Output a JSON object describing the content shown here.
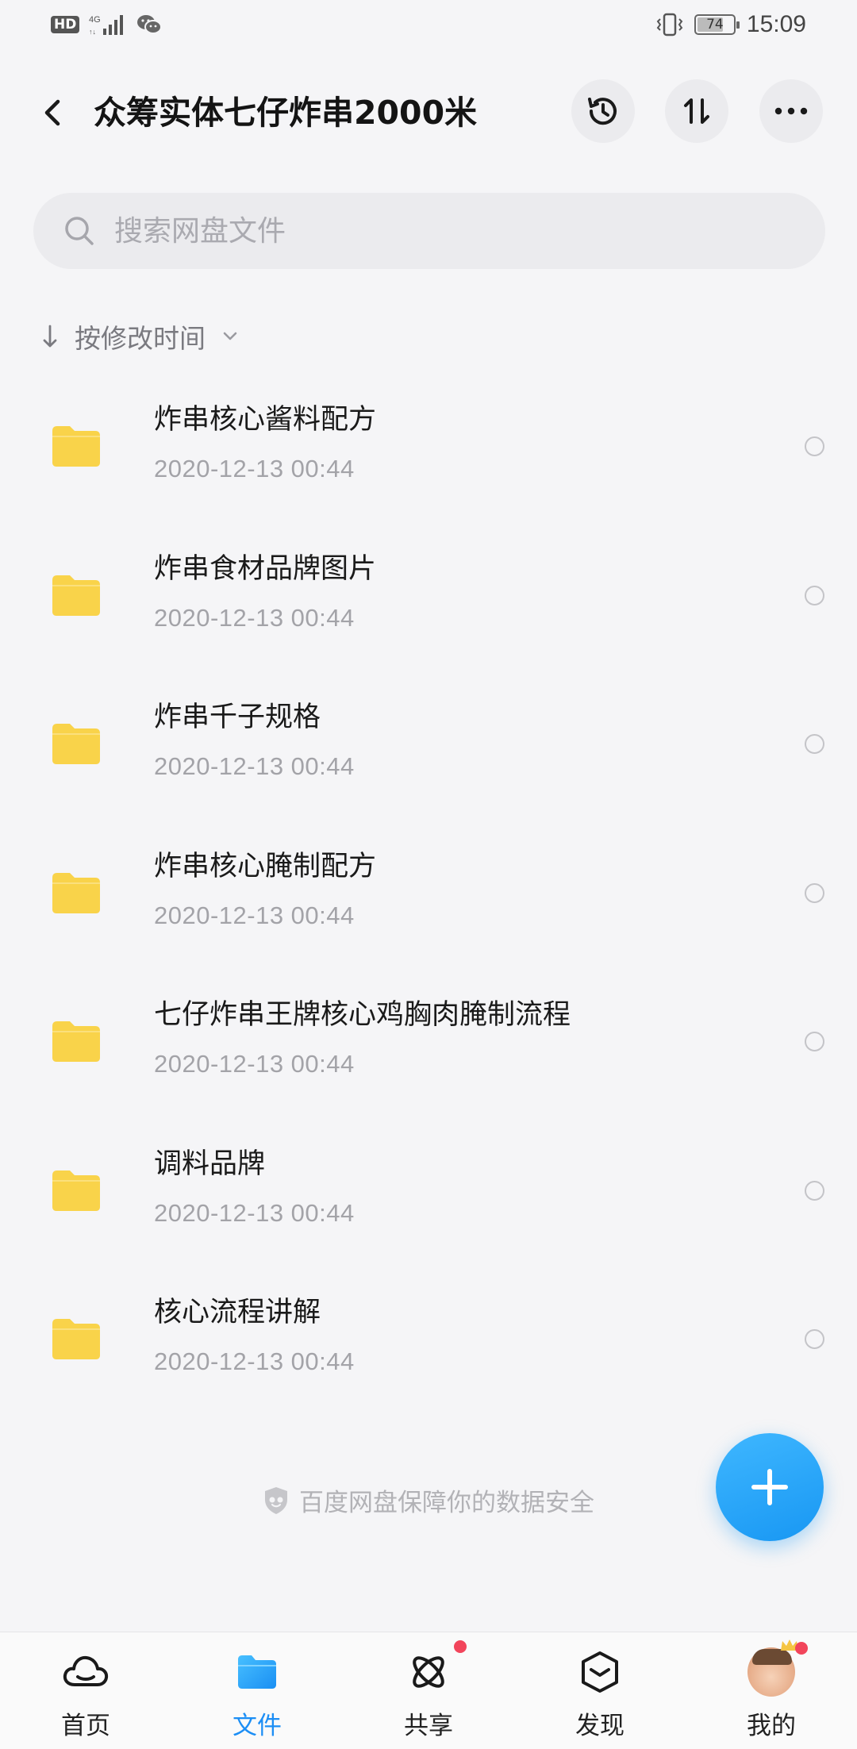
{
  "status_bar": {
    "hd_label": "HD",
    "battery_level": 74,
    "battery_text": "74",
    "time": "15:09"
  },
  "header": {
    "title": "众筹实体七仔炸串2000米"
  },
  "search": {
    "placeholder": "搜索网盘文件"
  },
  "sort": {
    "label": "按修改时间"
  },
  "files": [
    {
      "name": "炸串核心酱料配方",
      "date": "2020-12-13  00:44"
    },
    {
      "name": "炸串食材品牌图片",
      "date": "2020-12-13  00:44"
    },
    {
      "name": "炸串千子规格",
      "date": "2020-12-13  00:44"
    },
    {
      "name": "炸串核心腌制配方",
      "date": "2020-12-13  00:44"
    },
    {
      "name": "七仔炸串王牌核心鸡胸肉腌制流程",
      "date": "2020-12-13  00:44"
    },
    {
      "name": "调料品牌",
      "date": "2020-12-13  00:44"
    },
    {
      "name": "核心流程讲解",
      "date": "2020-12-13  00:44"
    }
  ],
  "footer_note": "百度网盘保障你的数据安全",
  "bottom_nav": {
    "items": [
      {
        "label": "首页",
        "icon": "cloud-icon"
      },
      {
        "label": "文件",
        "icon": "folder-icon",
        "active": true
      },
      {
        "label": "共享",
        "icon": "atom-icon",
        "badge": true
      },
      {
        "label": "发现",
        "icon": "cube-icon"
      },
      {
        "label": "我的",
        "icon": "avatar",
        "badge": true
      }
    ]
  },
  "colors": {
    "accent": "#1c8ef5",
    "folder": "#f9d34a",
    "badge": "#f2455b",
    "background": "#f5f5f7"
  }
}
